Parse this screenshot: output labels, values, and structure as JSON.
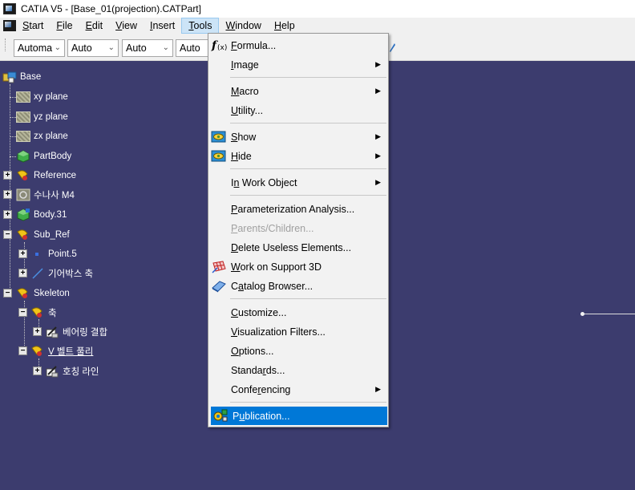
{
  "window": {
    "title": "CATIA V5 - [Base_01(projection).CATPart]"
  },
  "menubar": {
    "items": [
      {
        "label_pre": "",
        "label_u": "S",
        "label_post": "tart"
      },
      {
        "label_pre": "",
        "label_u": "F",
        "label_post": "ile"
      },
      {
        "label_pre": "",
        "label_u": "E",
        "label_post": "dit"
      },
      {
        "label_pre": "",
        "label_u": "V",
        "label_post": "iew"
      },
      {
        "label_pre": "",
        "label_u": "I",
        "label_post": "nsert"
      },
      {
        "label_pre": "",
        "label_u": "T",
        "label_post": "ools"
      },
      {
        "label_pre": "",
        "label_u": "W",
        "label_post": "indow"
      },
      {
        "label_pre": "",
        "label_u": "H",
        "label_post": "elp"
      }
    ]
  },
  "toolbar": {
    "combos": [
      "Automa",
      "Auto",
      "Auto",
      "Auto"
    ]
  },
  "tree": {
    "nodes": [
      {
        "label": "Base",
        "icon": "part-icon"
      },
      {
        "label": "xy plane",
        "icon": "plane-icon"
      },
      {
        "label": "yz plane",
        "icon": "plane-icon"
      },
      {
        "label": "zx plane",
        "icon": "plane-icon"
      },
      {
        "label": "PartBody",
        "icon": "body-icon"
      },
      {
        "label": "Reference",
        "icon": "geometrical-set-icon"
      },
      {
        "label": "수나사 M4",
        "icon": "thread-icon"
      },
      {
        "label": "Body.31",
        "icon": "body-icon"
      },
      {
        "label": "Sub_Ref",
        "icon": "geometrical-set-icon"
      },
      {
        "label": "Point.5",
        "icon": "point-icon"
      },
      {
        "label": "기어박스 축",
        "icon": "line-icon"
      },
      {
        "label": "Skeleton",
        "icon": "geometrical-set-icon"
      },
      {
        "label": "축",
        "icon": "geometrical-set-icon"
      },
      {
        "label": "베어링 결합",
        "icon": "sketch-icon"
      },
      {
        "label": "V 벨트 풀리",
        "icon": "geometrical-set-icon"
      },
      {
        "label": "호칭 라인",
        "icon": "sketch-icon"
      }
    ]
  },
  "tools_menu": {
    "items": [
      {
        "pre": "",
        "u": "F",
        "post": "ormula...",
        "icon": "formula-icon",
        "submenu": false,
        "disabled": false
      },
      {
        "pre": "",
        "u": "I",
        "post": "mage",
        "icon": "",
        "submenu": true,
        "disabled": false
      },
      {
        "pre": "",
        "u": "M",
        "post": "acro",
        "icon": "",
        "submenu": true,
        "disabled": false
      },
      {
        "pre": "",
        "u": "U",
        "post": "tility...",
        "icon": "",
        "submenu": false,
        "disabled": false
      },
      {
        "pre": "",
        "u": "S",
        "post": "how",
        "icon": "show-icon",
        "submenu": true,
        "disabled": false
      },
      {
        "pre": "",
        "u": "H",
        "post": "ide",
        "icon": "hide-icon",
        "submenu": true,
        "disabled": false
      },
      {
        "pre": "I",
        "u": "n",
        "post": " Work Object",
        "icon": "",
        "submenu": true,
        "disabled": false
      },
      {
        "pre": "",
        "u": "P",
        "post": "arameterization Analysis...",
        "icon": "",
        "submenu": false,
        "disabled": false
      },
      {
        "pre": "",
        "u": "P",
        "post": "arents/Children...",
        "icon": "",
        "submenu": false,
        "disabled": true
      },
      {
        "pre": "",
        "u": "D",
        "post": "elete Useless Elements...",
        "icon": "",
        "submenu": false,
        "disabled": false
      },
      {
        "pre": "",
        "u": "W",
        "post": "ork on Support 3D",
        "icon": "grid-icon",
        "submenu": false,
        "disabled": false
      },
      {
        "pre": "C",
        "u": "a",
        "post": "talog Browser...",
        "icon": "catalog-icon",
        "submenu": false,
        "disabled": false
      },
      {
        "pre": "",
        "u": "C",
        "post": "ustomize...",
        "icon": "",
        "submenu": false,
        "disabled": false
      },
      {
        "pre": "",
        "u": "V",
        "post": "isualization Filters...",
        "icon": "",
        "submenu": false,
        "disabled": false
      },
      {
        "pre": "",
        "u": "O",
        "post": "ptions...",
        "icon": "",
        "submenu": false,
        "disabled": false
      },
      {
        "pre": "Standa",
        "u": "r",
        "post": "ds...",
        "icon": "",
        "submenu": false,
        "disabled": false
      },
      {
        "pre": "Confe",
        "u": "r",
        "post": "encing",
        "icon": "",
        "submenu": true,
        "disabled": false
      },
      {
        "pre": "P",
        "u": "u",
        "post": "blication...",
        "icon": "publication-icon",
        "submenu": false,
        "disabled": false
      }
    ]
  }
}
